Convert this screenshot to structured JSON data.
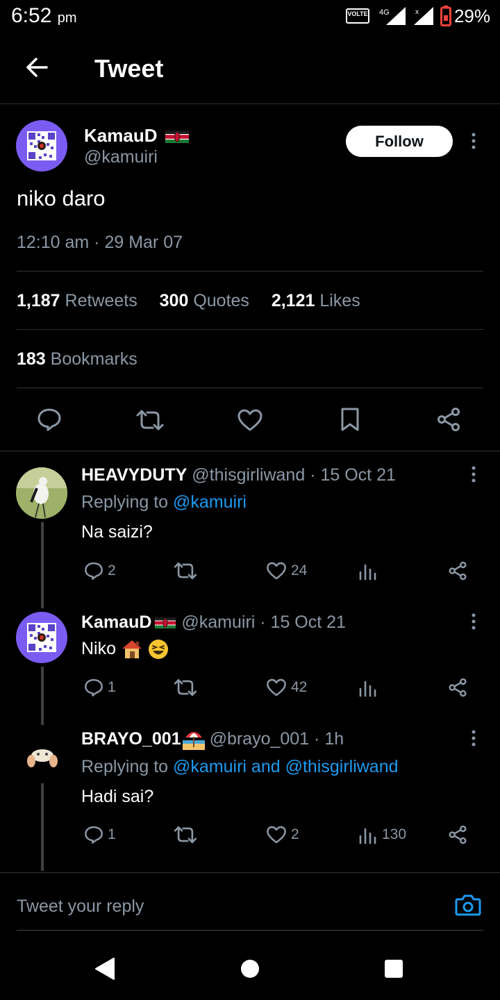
{
  "status_bar": {
    "time": "6:52",
    "ampm": "pm",
    "volte": "VOLTE",
    "network": "4G",
    "battery": "29%"
  },
  "header": {
    "title": "Tweet"
  },
  "main_tweet": {
    "author_name": "KamauD",
    "author_handle": "@kamuiri",
    "follow_label": "Follow",
    "text": "niko daro",
    "timestamp": "12:10 am · 29 Mar 07",
    "retweets_count": "1,187",
    "retweets_label": "Retweets",
    "quotes_count": "300",
    "quotes_label": "Quotes",
    "likes_count": "2,121",
    "likes_label": "Likes",
    "bookmarks_count": "183",
    "bookmarks_label": "Bookmarks"
  },
  "replies": [
    {
      "name": "HEAVYDUTY",
      "handle": "@thisgirliwand",
      "date": "· 15 Oct 21",
      "replying_prefix": "Replying to",
      "replying_to": "@kamuiri",
      "text": "Na saizi?",
      "reply_count": "2",
      "like_count": "24",
      "view_count": ""
    },
    {
      "name": "KamauD",
      "handle": "@kamuiri",
      "date": "· 15 Oct 21",
      "text": "Niko",
      "reply_count": "1",
      "like_count": "42",
      "view_count": ""
    },
    {
      "name": "BRAYO_001",
      "handle": "@brayo_001",
      "date": "· 1h",
      "replying_prefix": "Replying to",
      "replying_to": "@kamuiri and @thisgirliwand",
      "text": "Hadi sai?",
      "reply_count": "1",
      "like_count": "2",
      "view_count": "130"
    }
  ],
  "composer": {
    "placeholder": "Tweet your reply"
  },
  "colors": {
    "accent": "#1d9bf0",
    "background": "#000000",
    "muted": "#8b98a5",
    "divider": "#2f3336"
  },
  "icons": {
    "reply": "reply-icon",
    "retweet": "retweet-icon",
    "like": "heart-icon",
    "bookmark": "bookmark-icon",
    "share": "share-icon",
    "views": "views-icon",
    "camera": "camera-icon",
    "back": "back-arrow-icon"
  }
}
